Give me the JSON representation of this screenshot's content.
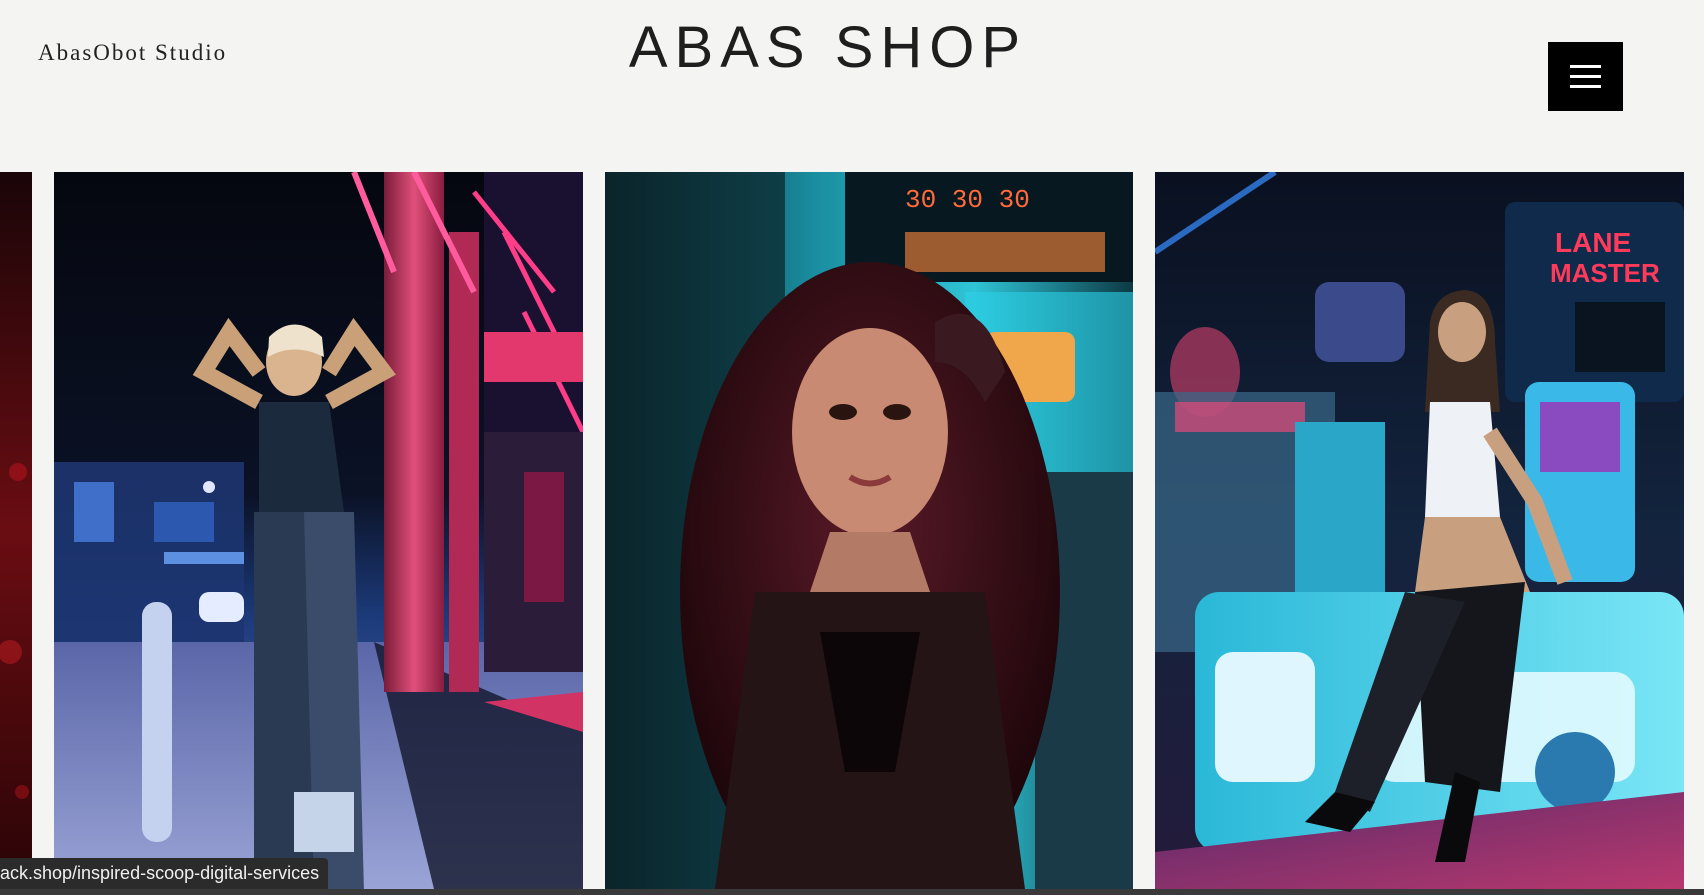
{
  "header": {
    "studio_name": "AbasObot Studio",
    "title": "ABAS SHOP",
    "menu_icon": "hamburger-menu-icon"
  },
  "gallery": {
    "photos": [
      {
        "description": "partial-red-photo"
      },
      {
        "description": "woman-neon-street-pink-blue"
      },
      {
        "description": "woman-portrait-arcade-teal"
      },
      {
        "description": "woman-seated-arcade-machine"
      }
    ]
  },
  "status_bar": {
    "url": "ack.shop/inspired-scoop-digital-services"
  },
  "colors": {
    "background": "#f4f4f2",
    "menu_button": "#000000",
    "status_bar": "#2b2b2b"
  }
}
